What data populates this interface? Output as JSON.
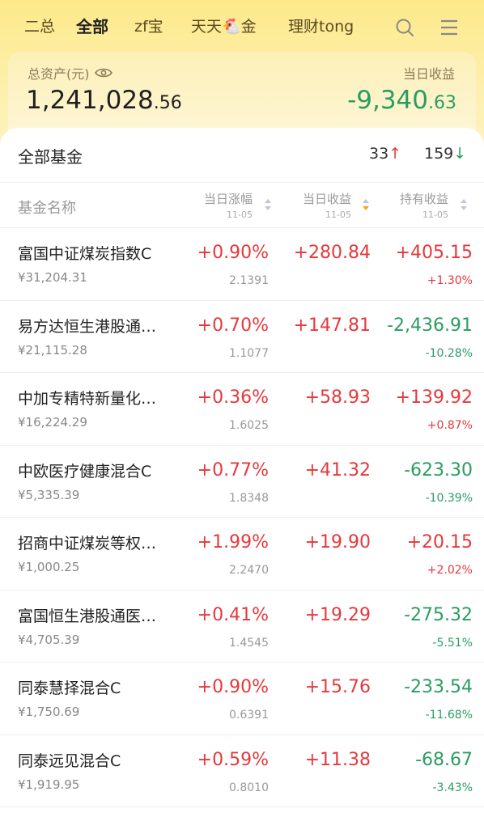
{
  "nav": {
    "tabs": [
      {
        "label": "二总",
        "active": false
      },
      {
        "label": "全部",
        "active": true
      },
      {
        "label": "zf宝",
        "active": false
      },
      {
        "label": "天天🐔金",
        "active": false
      },
      {
        "label": "理财tong",
        "active": false
      }
    ],
    "search_icon": "search-icon",
    "menu_icon": "menu-icon"
  },
  "summary": {
    "asset_label": "总资产(元)",
    "asset_int": "1,241,028",
    "asset_dec": ".56",
    "daily_label": "当日收益",
    "daily_int": "-9,340",
    "daily_dec": ".63"
  },
  "list": {
    "title": "全部基金",
    "up_count": "33",
    "down_count": "159",
    "up_arrow": "↑",
    "down_arrow": "↓",
    "columns": {
      "name": "基金名称",
      "change": "当日涨幅",
      "change_date": "11-05",
      "daily": "当日收益",
      "daily_date": "11-05",
      "hold": "持有收益",
      "hold_date": "11-05"
    },
    "funds": [
      {
        "name": "富国中证煤炭指数C",
        "amount": "¥31,204.31",
        "change": "+0.90%",
        "nav": "2.1391",
        "daily": "+280.84",
        "hold": "+405.15",
        "hold_pct": "+1.30%",
        "hold_color": "red"
      },
      {
        "name": "易方达恒生港股通…",
        "amount": "¥21,115.28",
        "change": "+0.70%",
        "nav": "1.1077",
        "daily": "+147.81",
        "hold": "-2,436.91",
        "hold_pct": "-10.28%",
        "hold_color": "green"
      },
      {
        "name": "中加专精特新量化…",
        "amount": "¥16,224.29",
        "change": "+0.36%",
        "nav": "1.6025",
        "daily": "+58.93",
        "hold": "+139.92",
        "hold_pct": "+0.87%",
        "hold_color": "red"
      },
      {
        "name": "中欧医疗健康混合C",
        "amount": "¥5,335.39",
        "change": "+0.77%",
        "nav": "1.8348",
        "daily": "+41.32",
        "hold": "-623.30",
        "hold_pct": "-10.39%",
        "hold_color": "green"
      },
      {
        "name": "招商中证煤炭等权…",
        "amount": "¥1,000.25",
        "change": "+1.99%",
        "nav": "2.2470",
        "daily": "+19.90",
        "hold": "+20.15",
        "hold_pct": "+2.02%",
        "hold_color": "red"
      },
      {
        "name": "富国恒生港股通医…",
        "amount": "¥4,705.39",
        "change": "+0.41%",
        "nav": "1.4545",
        "daily": "+19.29",
        "hold": "-275.32",
        "hold_pct": "-5.51%",
        "hold_color": "green"
      },
      {
        "name": "同泰慧择混合C",
        "amount": "¥1,750.69",
        "change": "+0.90%",
        "nav": "0.6391",
        "daily": "+15.76",
        "hold": "-233.54",
        "hold_pct": "-11.68%",
        "hold_color": "green"
      },
      {
        "name": "同泰远见混合C",
        "amount": "¥1,919.95",
        "change": "+0.59%",
        "nav": "0.8010",
        "daily": "+11.38",
        "hold": "-68.67",
        "hold_pct": "-3.43%",
        "hold_color": "green"
      }
    ]
  },
  "colors": {
    "up": "#e5393c",
    "down": "#2a9d62",
    "header_bg": "#fde98a"
  }
}
